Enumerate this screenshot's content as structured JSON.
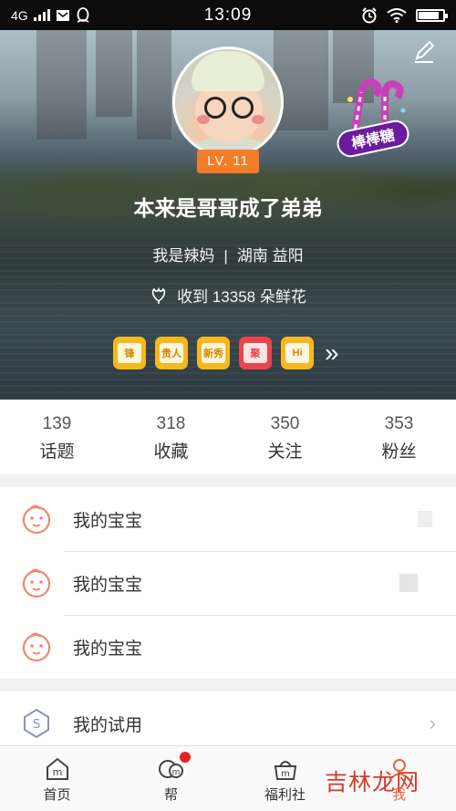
{
  "status_bar": {
    "network": "4G",
    "time": "13:09"
  },
  "profile": {
    "level": "LV. 11",
    "nickname": "本来是哥哥成了弟弟",
    "role": "我是辣妈",
    "separator": "|",
    "location": "湖南 益阳",
    "flowers_text": "收到 13358 朵鲜花",
    "candy_badge": "棒棒糖"
  },
  "badges": [
    {
      "label": "锋",
      "color": "#f6b81e"
    },
    {
      "label": "贵人",
      "color": "#f6b81e"
    },
    {
      "label": "新秀",
      "color": "#f6b81e"
    },
    {
      "label": "聚",
      "color": "#e8464a"
    },
    {
      "label": "Hi",
      "color": "#f6b81e"
    }
  ],
  "more_badges": "»",
  "stats": [
    {
      "num": "139",
      "label": "话题"
    },
    {
      "num": "318",
      "label": "收藏"
    },
    {
      "num": "350",
      "label": "关注"
    },
    {
      "num": "353",
      "label": "粉丝"
    }
  ],
  "babies": [
    {
      "label": "我的宝宝"
    },
    {
      "label": "我的宝宝"
    },
    {
      "label": "我的宝宝"
    }
  ],
  "trial": {
    "label": "我的试用",
    "chevron": "›"
  },
  "tabs": [
    {
      "label": "首页"
    },
    {
      "label": "帮"
    },
    {
      "label": "福利社"
    },
    {
      "label": "我"
    }
  ],
  "watermark": "吉林龙网",
  "colors": {
    "accent": "#f47c28",
    "active_tab": "#e8683b",
    "badge_dot": "#e52222"
  }
}
